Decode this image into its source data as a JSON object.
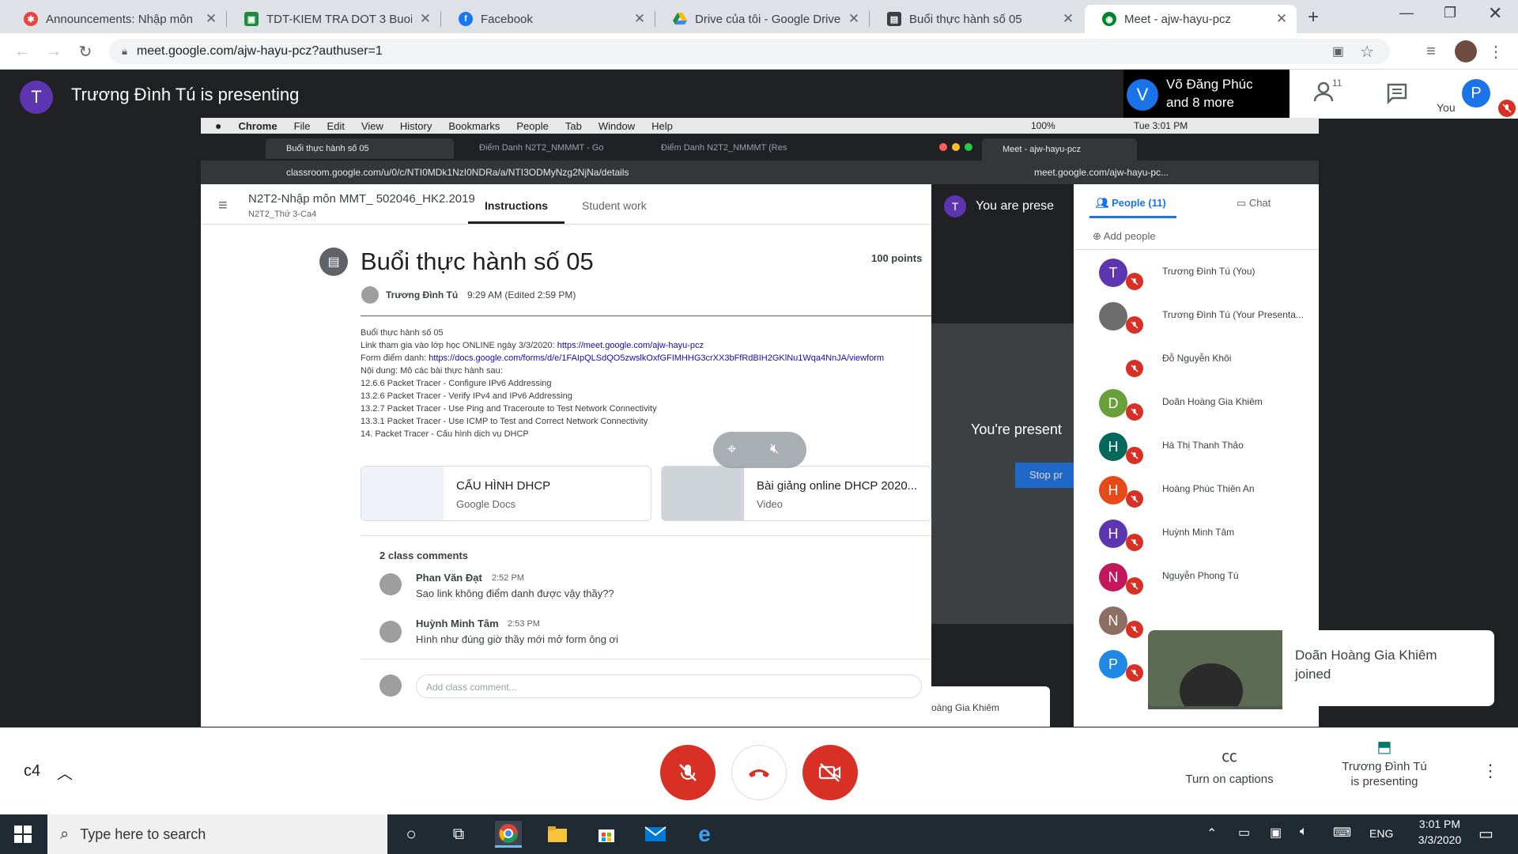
{
  "browser": {
    "tabs": [
      {
        "title": "Announcements: Nhập môn",
        "icon": "classroom-icon",
        "color": "#e8453c"
      },
      {
        "title": "TDT-KIEM TRA DOT 3 Buoi 5",
        "icon": "classroom-icon",
        "color": "#1e8e3e"
      },
      {
        "title": "Facebook",
        "icon": "facebook-icon",
        "color": "#1877f2"
      },
      {
        "title": "Drive của tôi - Google Drive",
        "icon": "drive-icon",
        "color": "#fbbc04"
      },
      {
        "title": "Buổi thực hành số 05",
        "icon": "assignment-icon",
        "color": "#3c4043"
      },
      {
        "title": "Meet - ajw-hayu-pcz",
        "icon": "meet-icon",
        "color": "#00832d"
      }
    ],
    "url": "meet.google.com/ajw-hayu-pcz?authuser=1"
  },
  "meet": {
    "presenter_initial": "T",
    "presenter_title": "Trương Đình Tú is presenting",
    "speaker_initial": "V",
    "speaker_name": "Võ Đăng Phúc",
    "speaker_more": "and 8 more",
    "participants_count": "11",
    "you_label": "You",
    "you_initial": "P",
    "meeting_code": "c4",
    "captions_label": "Turn on captions",
    "presenting_label_1": "Trương Đình Tú",
    "presenting_label_2": "is presenting",
    "toast": {
      "name": "Doãn Hoàng Gia Khiêm",
      "suffix": "joined"
    }
  },
  "shared": {
    "mac_menu": [
      "Chrome",
      "File",
      "Edit",
      "View",
      "History",
      "Bookmarks",
      "People",
      "Tab",
      "Window",
      "Help"
    ],
    "mac_status": "100%",
    "mac_time": "Tue 3:01 PM",
    "left_tabs": [
      "Buổi thực hành số 05",
      "Điểm Danh N2T2_NMMMT - Go",
      "Điểm Danh N2T2_NMMMT (Res"
    ],
    "left_url": "classroom.google.com/u/0/c/NTI0MDk1NzI0NDRa/a/NTI3ODMyNzg2NjNa/details",
    "class_name": "N2T2-Nhập môn MMT_ 502046_HK2.2019",
    "class_sub": "N2T2_Thứ 3-Ca4",
    "tab_instructions": "Instructions",
    "tab_student_work": "Student work",
    "assignment_title": "Buổi thực hành số 05",
    "points": "100 points",
    "author": "Trương Đình Tú",
    "posted": "9:29 AM (Edited 2:59 PM)",
    "desc_line1": "Buổi thực hành số 05",
    "desc_link_prefix": "Link tham gia vào lớp học ONLINE ngày 3/3/2020: ",
    "desc_link": "https://meet.google.com/ajw-hayu-pcz",
    "desc_form_prefix": "Form điểm danh: ",
    "desc_form": "https://docs.google.com/forms/d/e/1FAIpQLSdQO5zwslkOxfGFIMHHG3crXX3bFfRdBIH2GKlNu1Wqa4NnJA/viewform",
    "desc_lines": [
      "Nội dung: Mô các bài thực hành sau:",
      "12.6.6 Packet Tracer - Configure IPv6 Addressing",
      "13.2.6 Packet Tracer - Verify IPv4 and IPv6 Addressing",
      "13.2.7 Packet Tracer - Use Ping and Traceroute to Test Network Connectivity",
      "13.3.1 Packet Tracer - Use ICMP to Test and Correct Network Connectivity",
      "14. Packet Tracer - Cấu hình dịch vụ DHCP"
    ],
    "attach1": {
      "title": "CẤU HÌNH DHCP",
      "type": "Google Docs"
    },
    "attach2": {
      "title": "Bài giảng online DHCP 2020...",
      "type": "Video"
    },
    "comments_header": "2 class comments",
    "comments": [
      {
        "name": "Phan Văn Đạt",
        "time": "2:52 PM",
        "text": "Sao link không điểm danh được vậy thầy??"
      },
      {
        "name": "Huỳnh Minh Tâm",
        "time": "2:53 PM",
        "text": "Hình như đúng giờ thầy mới mở form ông ơi"
      }
    ],
    "comment_placeholder": "Add class comment...",
    "right_tab": "Meet - ajw-hayu-pcz",
    "right_url": "meet.google.com/ajw-hayu-pc...",
    "right_you_present": "You are prese",
    "right_presenting": "You're present",
    "right_stop": "Stop pr",
    "right_bottom_name": "oàng Gia Khiêm",
    "panel_people": "People (11)",
    "panel_chat": "Chat",
    "add_people": "Add people",
    "people": [
      {
        "initial": "T",
        "name": "Trương Đình Tú (You)",
        "color": "#5e35b1"
      },
      {
        "initial": "",
        "name": "Trương Đình Tú (Your Presenta...",
        "color": "#6d6d6d"
      },
      {
        "initial": "",
        "name": "Đỗ Nguyễn Khôi",
        "color": "#ffffff"
      },
      {
        "initial": "D",
        "name": "Doãn Hoàng Gia Khiêm",
        "color": "#689f38"
      },
      {
        "initial": "H",
        "name": "Hà Thị Thanh Thảo",
        "color": "#00695c"
      },
      {
        "initial": "H",
        "name": "Hoàng Phúc Thiên An",
        "color": "#e64a19"
      },
      {
        "initial": "H",
        "name": "Huỳnh Minh Tâm",
        "color": "#5e35b1"
      },
      {
        "initial": "N",
        "name": "Nguyễn Phong Tú",
        "color": "#c2185b"
      },
      {
        "initial": "N",
        "name": "",
        "color": "#8d6e63"
      },
      {
        "initial": "P",
        "name": "",
        "color": "#1e88e5"
      }
    ]
  },
  "taskbar": {
    "search_placeholder": "Type here to search",
    "lang": "ENG",
    "time": "3:01 PM",
    "date": "3/3/2020"
  },
  "colors": {
    "red": "#d93025",
    "meet_dark": "#202124",
    "taskbar": "#1f2a33"
  }
}
